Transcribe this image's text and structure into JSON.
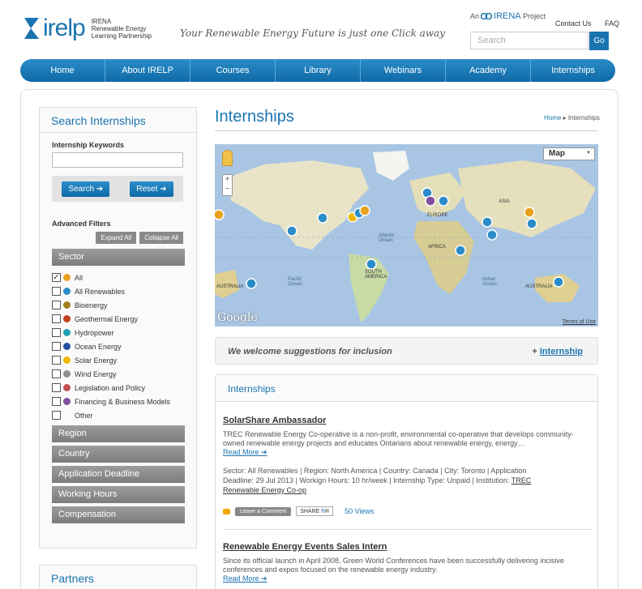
{
  "header": {
    "logo_text": "irelp",
    "logo_sub_1": "IRENA",
    "logo_sub_2": "Renewable Energy",
    "logo_sub_3": "Learning Partnership",
    "tagline": "Your Renewable Energy Future is just one Click away",
    "irena_prefix": "An",
    "irena_name": "IRENA",
    "irena_suffix": "Project",
    "contact": "Contact Us",
    "faq": "FAQ",
    "search_placeholder": "Search",
    "go_label": "Go"
  },
  "nav": {
    "items": [
      "Home",
      "About IRELP",
      "Courses",
      "Library",
      "Webinars",
      "Academy",
      "Internships"
    ]
  },
  "sidebar": {
    "title": "Search Internships",
    "keywords_label": "Internship Keywords",
    "search_btn": "Search",
    "reset_btn": "Reset",
    "advanced_label": "Advanced Filters",
    "expand_all": "Expand All",
    "collapse_all": "Collapse All",
    "sector_label": "Sector",
    "sector_options": [
      {
        "label": "All",
        "checked": true,
        "color": "#e8a020"
      },
      {
        "label": "All Renewables",
        "checked": false,
        "color": "#2a8cc8"
      },
      {
        "label": "Bioenergy",
        "checked": false,
        "color": "#a08020"
      },
      {
        "label": "Geothermal Energy",
        "checked": false,
        "color": "#c04020"
      },
      {
        "label": "Hydropower",
        "checked": false,
        "color": "#20a0b0"
      },
      {
        "label": "Ocean Energy",
        "checked": false,
        "color": "#2050a0"
      },
      {
        "label": "Solar Energy",
        "checked": false,
        "color": "#f0b800"
      },
      {
        "label": "Wind Energy",
        "checked": false,
        "color": "#909090"
      },
      {
        "label": "Legislation and Policy",
        "checked": false,
        "color": "#c05050"
      },
      {
        "label": "Financing & Business Models",
        "checked": false,
        "color": "#8050a0"
      },
      {
        "label": "Other",
        "checked": false,
        "color": ""
      }
    ],
    "region_label": "Region",
    "country_label": "Country",
    "deadline_label": "Application Deadline",
    "hours_label": "Working Hours",
    "compensation_label": "Compensation",
    "partners_title": "Partners"
  },
  "main": {
    "title": "Internships",
    "breadcrumb_home": "Home",
    "breadcrumb_current": "Internships",
    "map": {
      "type_label": "Map",
      "labels": {
        "asia": "ASIA",
        "europe": "EUROPE",
        "africa": "AFRICA",
        "south_america": "SOUTH AMERICA",
        "australia_left": "AUSTRALIA",
        "australia_right": "AUSTRALIA",
        "atlantic": "Atlantic Ocean",
        "pacific": "Pacific Ocean",
        "indian": "Indian Ocean"
      },
      "google": "Google",
      "terms": "Terms of Use"
    },
    "suggest_text": "We welcome suggestions for inclusion",
    "suggest_plus": "+",
    "suggest_link": "Internship",
    "listing_title": "Internships",
    "jobs": [
      {
        "title": "SolarShare Ambassador",
        "desc": "TREC Renewable Energy Co-operative is a non-profit, environmental co-operative that develops community-owned renewable energy projects and educates Ontarians about renewable energy, energy…",
        "read_more": "Read More",
        "meta_line1": "Sector: All Renewables   |  Region: North America   |  Country: Canada   |  City: Toronto   |  Application",
        "meta_line2": "Deadline: 29 Jul 2013   |  Workign Hours: 10 hr/week   |  Internship Type: Unpaid   |  Institution:",
        "institution_a": "TREC",
        "institution_b": "Renewable Energy Co-op",
        "leave_comment": "Leave a Comment",
        "share": "SHARE",
        "views": "50 Views"
      },
      {
        "title": "Renewable Energy Events Sales Intern",
        "desc": "Since its official launch in April 2008, Green World Conferences have been successfully delivering incisive conferences and expos focused on the renewable energy industry.",
        "read_more": "Read More"
      }
    ]
  }
}
